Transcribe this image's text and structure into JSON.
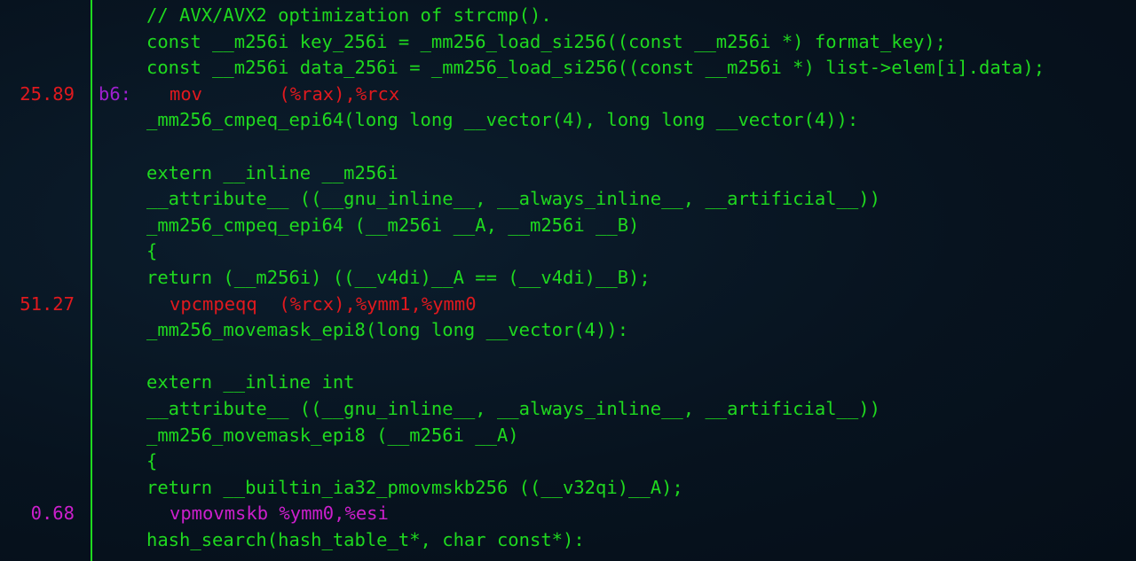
{
  "colors": {
    "source": "#1fd91f",
    "hot": "#e0191e",
    "warm": "#cc1fcc",
    "label": "#a020d0",
    "divider": "#1fd91f",
    "background": "#07131f"
  },
  "lines": [
    {
      "pct": "",
      "label": "",
      "text": "// AVX/AVX2 optimization of strcmp().",
      "kind": "src"
    },
    {
      "pct": "",
      "label": "",
      "text": "const __m256i key_256i = _mm256_load_si256((const __m256i *) format_key);",
      "kind": "src"
    },
    {
      "pct": "",
      "label": "",
      "text": "const __m256i data_256i = _mm256_load_si256((const __m256i *) list->elem[i].data);",
      "kind": "src"
    },
    {
      "pct": "25.89",
      "label": "b6:",
      "text": "mov       (%rax),%rcx",
      "kind": "hot"
    },
    {
      "pct": "",
      "label": "",
      "text": "_mm256_cmpeq_epi64(long long __vector(4), long long __vector(4)):",
      "kind": "src"
    },
    {
      "pct": "",
      "label": "",
      "text": "",
      "kind": "src"
    },
    {
      "pct": "",
      "label": "",
      "text": "extern __inline __m256i",
      "kind": "src"
    },
    {
      "pct": "",
      "label": "",
      "text": "__attribute__ ((__gnu_inline__, __always_inline__, __artificial__))",
      "kind": "src"
    },
    {
      "pct": "",
      "label": "",
      "text": "_mm256_cmpeq_epi64 (__m256i __A, __m256i __B)",
      "kind": "src"
    },
    {
      "pct": "",
      "label": "",
      "text": "{",
      "kind": "src"
    },
    {
      "pct": "",
      "label": "",
      "text": "return (__m256i) ((__v4di)__A == (__v4di)__B);",
      "kind": "src"
    },
    {
      "pct": "51.27",
      "label": "",
      "text": "vpcmpeqq  (%rcx),%ymm1,%ymm0",
      "kind": "hot"
    },
    {
      "pct": "",
      "label": "",
      "text": "_mm256_movemask_epi8(long long __vector(4)):",
      "kind": "src"
    },
    {
      "pct": "",
      "label": "",
      "text": "",
      "kind": "src"
    },
    {
      "pct": "",
      "label": "",
      "text": "extern __inline int",
      "kind": "src"
    },
    {
      "pct": "",
      "label": "",
      "text": "__attribute__ ((__gnu_inline__, __always_inline__, __artificial__))",
      "kind": "src"
    },
    {
      "pct": "",
      "label": "",
      "text": "_mm256_movemask_epi8 (__m256i __A)",
      "kind": "src"
    },
    {
      "pct": "",
      "label": "",
      "text": "{",
      "kind": "src"
    },
    {
      "pct": "",
      "label": "",
      "text": "return __builtin_ia32_pmovmskb256 ((__v32qi)__A);",
      "kind": "src"
    },
    {
      "pct": "0.68",
      "label": "",
      "text": "vpmovmskb %ymm0,%esi",
      "kind": "warm"
    },
    {
      "pct": "",
      "label": "",
      "text": "hash_search(hash_table_t*, char const*):",
      "kind": "src"
    }
  ]
}
